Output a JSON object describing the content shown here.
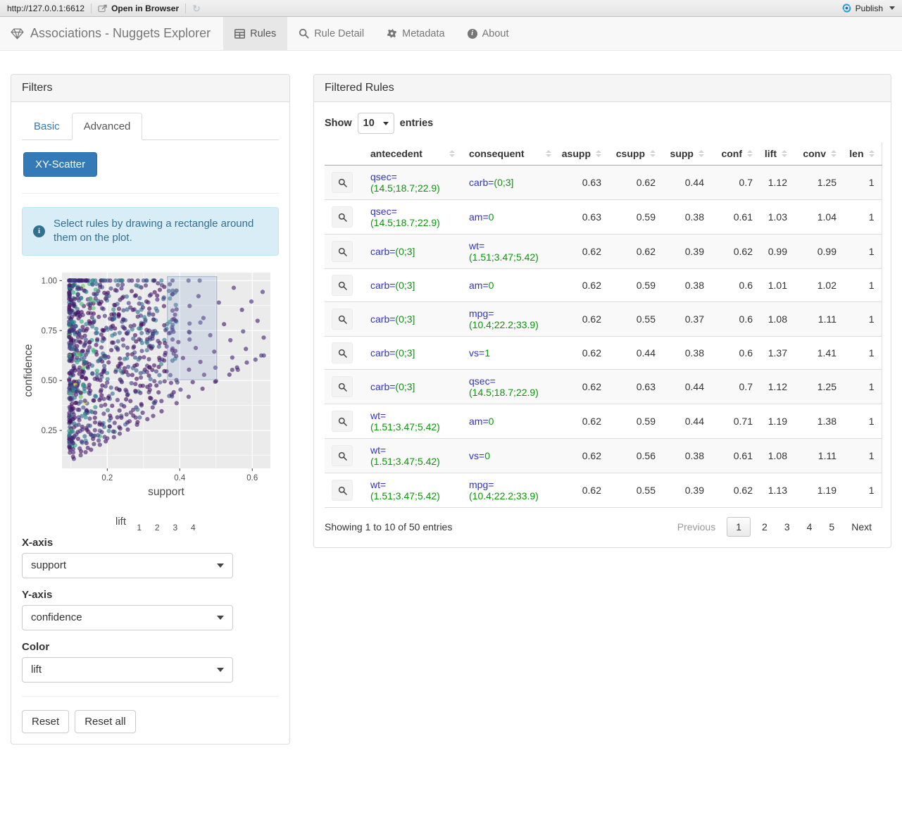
{
  "topbar": {
    "url": "http://127.0.0.1:6612",
    "open_in_browser": "Open in Browser",
    "publish": "Publish"
  },
  "navbar": {
    "brand": "Associations - Nuggets Explorer",
    "tabs": [
      {
        "label": "Rules",
        "icon": "table-icon",
        "active": true
      },
      {
        "label": "Rule Detail",
        "icon": "search-icon",
        "active": false
      },
      {
        "label": "Metadata",
        "icon": "gear-icon",
        "active": false
      },
      {
        "label": "About",
        "icon": "info-icon",
        "active": false
      }
    ]
  },
  "filters": {
    "title": "Filters",
    "tabs": [
      {
        "label": "Basic",
        "active": false
      },
      {
        "label": "Advanced",
        "active": true
      }
    ],
    "scatter_button": "XY-Scatter",
    "alert": "Select rules by drawing a rectangle around them on the plot.",
    "controls": [
      {
        "label": "X-axis",
        "value": "support"
      },
      {
        "label": "Y-axis",
        "value": "confidence"
      },
      {
        "label": "Color",
        "value": "lift"
      }
    ],
    "reset": "Reset",
    "reset_all": "Reset all"
  },
  "chart": {
    "type": "scatter",
    "xlabel": "support",
    "ylabel": "confidence",
    "x_ticks": [
      "0.2",
      "0.4",
      "0.6"
    ],
    "x_tick_vals": [
      0.2,
      0.4,
      0.6
    ],
    "y_ticks": [
      "0.25",
      "0.50",
      "0.75",
      "1.00"
    ],
    "y_tick_vals": [
      0.25,
      0.5,
      0.75,
      1.0
    ],
    "x_minor": [
      0.1,
      0.3,
      0.5
    ],
    "y_minor": [
      0.125,
      0.375,
      0.625,
      0.875
    ],
    "x_range": [
      0.075,
      0.65
    ],
    "y_range": [
      0.06,
      1.04
    ],
    "panel_bg": "#EBEBEB",
    "brush": {
      "x0": 0.366,
      "x1": 0.502,
      "y0": 0.503,
      "y1": 1.02
    },
    "seed": 42,
    "n_points": 760,
    "palette": "viridis",
    "legend": {
      "label": "lift",
      "ticks": [
        "1",
        "2",
        "3",
        "4"
      ],
      "tick_pos": [
        0.086,
        0.312,
        0.538,
        0.764
      ],
      "lift_range": [
        0.62,
        5.05
      ]
    }
  },
  "rules_panel": {
    "title": "Filtered Rules",
    "show_label": "Show",
    "entries_label": "entries",
    "page_length": "10",
    "columns": [
      "",
      "antecedent",
      "consequent",
      "asupp",
      "csupp",
      "supp",
      "conf",
      "lift",
      "conv",
      "len"
    ],
    "rows": [
      {
        "a_attr": "qsec=",
        "a_val": "(14.5;18.7;22.9)",
        "c_attr": "carb=",
        "c_val": "(0;3]",
        "asupp": "0.63",
        "csupp": "0.62",
        "supp": "0.44",
        "conf": "0.7",
        "lift": "1.12",
        "conv": "1.25",
        "len": "1"
      },
      {
        "a_attr": "qsec=",
        "a_val": "(14.5;18.7;22.9)",
        "c_attr": "am=",
        "c_val": "0",
        "asupp": "0.63",
        "csupp": "0.59",
        "supp": "0.38",
        "conf": "0.61",
        "lift": "1.03",
        "conv": "1.04",
        "len": "1"
      },
      {
        "a_attr": "carb=",
        "a_val": "(0;3]",
        "c_attr": "wt=",
        "c_val": "(1.51;3.47;5.42)",
        "asupp": "0.62",
        "csupp": "0.62",
        "supp": "0.39",
        "conf": "0.62",
        "lift": "0.99",
        "conv": "0.99",
        "len": "1"
      },
      {
        "a_attr": "carb=",
        "a_val": "(0;3]",
        "c_attr": "am=",
        "c_val": "0",
        "asupp": "0.62",
        "csupp": "0.59",
        "supp": "0.38",
        "conf": "0.6",
        "lift": "1.01",
        "conv": "1.02",
        "len": "1"
      },
      {
        "a_attr": "carb=",
        "a_val": "(0;3]",
        "c_attr": "mpg=",
        "c_val": "(10.4;22.2;33.9)",
        "asupp": "0.62",
        "csupp": "0.55",
        "supp": "0.37",
        "conf": "0.6",
        "lift": "1.08",
        "conv": "1.11",
        "len": "1"
      },
      {
        "a_attr": "carb=",
        "a_val": "(0;3]",
        "c_attr": "vs=",
        "c_val": "1",
        "asupp": "0.62",
        "csupp": "0.44",
        "supp": "0.38",
        "conf": "0.6",
        "lift": "1.37",
        "conv": "1.41",
        "len": "1"
      },
      {
        "a_attr": "carb=",
        "a_val": "(0;3]",
        "c_attr": "qsec=",
        "c_val": "(14.5;18.7;22.9)",
        "asupp": "0.62",
        "csupp": "0.63",
        "supp": "0.44",
        "conf": "0.7",
        "lift": "1.12",
        "conv": "1.25",
        "len": "1"
      },
      {
        "a_attr": "wt=",
        "a_val": "(1.51;3.47;5.42)",
        "c_attr": "am=",
        "c_val": "0",
        "asupp": "0.62",
        "csupp": "0.59",
        "supp": "0.44",
        "conf": "0.71",
        "lift": "1.19",
        "conv": "1.38",
        "len": "1"
      },
      {
        "a_attr": "wt=",
        "a_val": "(1.51;3.47;5.42)",
        "c_attr": "vs=",
        "c_val": "0",
        "asupp": "0.62",
        "csupp": "0.56",
        "supp": "0.38",
        "conf": "0.61",
        "lift": "1.08",
        "conv": "1.11",
        "len": "1"
      },
      {
        "a_attr": "wt=",
        "a_val": "(1.51;3.47;5.42)",
        "c_attr": "mpg=",
        "c_val": "(10.4;22.2;33.9)",
        "asupp": "0.62",
        "csupp": "0.55",
        "supp": "0.39",
        "conf": "0.62",
        "lift": "1.13",
        "conv": "1.19",
        "len": "1"
      }
    ],
    "footer": {
      "info": "Showing 1 to 10 of 50 entries",
      "previous": "Previous",
      "pages": [
        "1",
        "2",
        "3",
        "4",
        "5"
      ],
      "current_page": "1",
      "next": "Next"
    }
  },
  "colors": {
    "accent": "#337ab7",
    "attr_color": "#3232c8",
    "value_color": "#0a960a",
    "alert_bg": "#d9edf7",
    "alert_text": "#31708f",
    "publish_blue": "#249fda",
    "active_tab_bg": "#e7e7e7"
  }
}
